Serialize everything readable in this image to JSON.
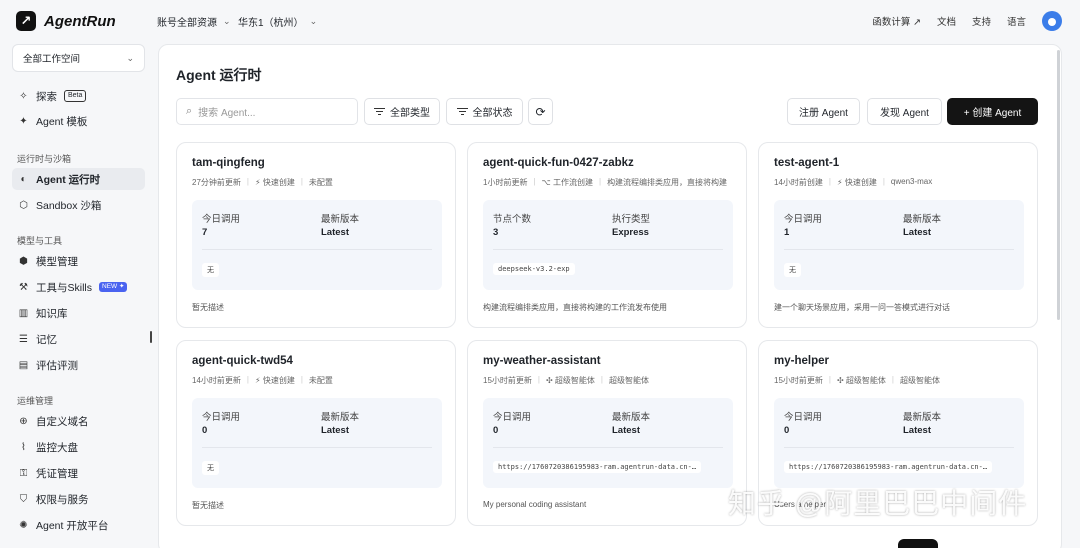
{
  "app": {
    "name": "AgentRun",
    "logo_glyph": "↗"
  },
  "topbar": {
    "account_scope": "账号全部资源",
    "region": "华东1（杭州）",
    "links": {
      "function_compute": "函数计算 ↗",
      "docs": "文档",
      "support": "支持",
      "language": "语言"
    }
  },
  "sidebar": {
    "workspace": "全部工作空间",
    "explore": "探索",
    "beta": "Beta",
    "agent_templates": "Agent 模板",
    "group_runtime": "运行时与沙箱",
    "agent_runtime": "Agent 运行时",
    "sandbox": "Sandbox 沙箱",
    "group_models": "模型与工具",
    "model_mgmt": "模型管理",
    "tools_skills": "工具与Skills",
    "new": "NEW ✦",
    "knowledge": "知识库",
    "memory": "记忆",
    "evaluation": "评估评测",
    "group_ops": "运维管理",
    "custom_domain": "自定义域名",
    "monitor": "监控大盘",
    "credentials": "凭证管理",
    "permissions": "权限与服务",
    "open_platform": "Agent 开放平台"
  },
  "main": {
    "title": "Agent 运行时",
    "search_placeholder": "搜索 Agent...",
    "filter_type": "全部类型",
    "filter_status": "全部状态",
    "register": "注册 Agent",
    "discover": "发现 Agent",
    "create": "+  创建 Agent"
  },
  "cards": [
    {
      "name": "tam-qingfeng",
      "time": "27分钟前更新",
      "kind": "⚡ 快速创建",
      "model": "未配置",
      "l_label": "今日调用",
      "l_value": "7",
      "r_label": "最新版本",
      "r_value": "Latest",
      "tag": "无",
      "desc": "暂无描述"
    },
    {
      "name": "agent-quick-fun-0427-zabkz",
      "time": "1小时前更新",
      "kind": "⌥ 工作流创建",
      "model": "构建流程编排类应用，直接将构建",
      "l_label": "节点个数",
      "l_value": "3",
      "r_label": "执行类型",
      "r_value": "Express",
      "tag": "deepseek-v3.2-exp",
      "desc": "构建流程编排类应用，直接将构建的工作流发布使用"
    },
    {
      "name": "test-agent-1",
      "time": "14小时前创建",
      "kind": "⚡ 快速创建",
      "model": "qwen3-max",
      "l_label": "今日调用",
      "l_value": "1",
      "r_label": "最新版本",
      "r_value": "Latest",
      "tag": "无",
      "desc": "建一个聊天场景应用，采用一问一答模式进行对话"
    },
    {
      "name": "agent-quick-twd54",
      "time": "14小时前更新",
      "kind": "⚡ 快速创建",
      "model": "未配置",
      "l_label": "今日调用",
      "l_value": "0",
      "r_label": "最新版本",
      "r_value": "Latest",
      "tag": "无",
      "desc": "暂无描述"
    },
    {
      "name": "my-weather-assistant",
      "time": "15小时前更新",
      "kind": "✣ 超级智能体",
      "model": "超级智能体",
      "l_label": "今日调用",
      "l_value": "0",
      "r_label": "最新版本",
      "r_value": "Latest",
      "tag": "https://1760720386195983-ram.agentrun-data.cn-…",
      "desc": "My personal coding assistant"
    },
    {
      "name": "my-helper",
      "time": "15小时前更新",
      "kind": "✣ 超级智能体",
      "model": "超级智能体",
      "l_label": "今日调用",
      "l_value": "0",
      "r_label": "最新版本",
      "r_value": "Latest",
      "tag": "https://1760720386195983-ram.agentrun-data.cn-…",
      "desc": "Users a helper"
    }
  ],
  "watermark": "知乎 @阿里巴巴中间件"
}
